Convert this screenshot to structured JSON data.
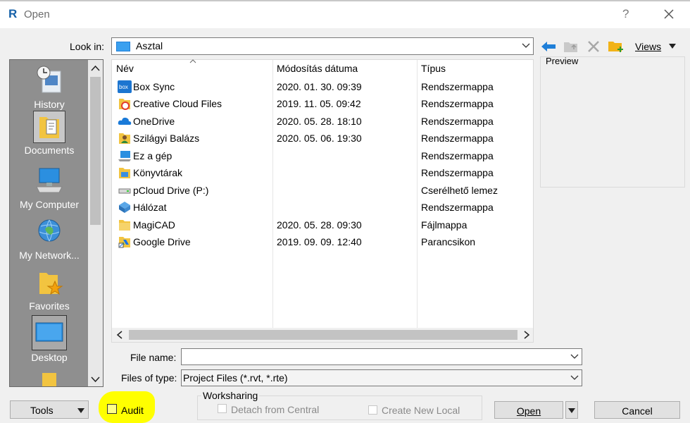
{
  "window": {
    "title": "Open",
    "help": "?"
  },
  "toolbar": {
    "lookin_label": "Look in:",
    "lookin_value": "Asztal",
    "views_label": "Views"
  },
  "preview": {
    "label": "Preview"
  },
  "places": [
    {
      "label": "History",
      "icon": "history-icon"
    },
    {
      "label": "Documents",
      "icon": "documents-icon"
    },
    {
      "label": "My Computer",
      "icon": "computer-icon"
    },
    {
      "label": "My Network...",
      "icon": "network-icon"
    },
    {
      "label": "Favorites",
      "icon": "favorites-icon"
    },
    {
      "label": "Desktop",
      "icon": "desktop-icon"
    }
  ],
  "files": {
    "columns": [
      "Név",
      "Módosítás dátuma",
      "Típus"
    ],
    "rows": [
      {
        "name": "Box Sync",
        "date": "2020. 01. 30. 09:39",
        "type": "Rendszermappa",
        "icon": "box-icon"
      },
      {
        "name": "Creative Cloud Files",
        "date": "2019. 11. 05. 09:42",
        "type": "Rendszermappa",
        "icon": "creative-cloud-icon"
      },
      {
        "name": "OneDrive",
        "date": "2020. 05. 28. 18:10",
        "type": "Rendszermappa",
        "icon": "onedrive-icon"
      },
      {
        "name": "Szilágyi Balázs",
        "date": "2020. 05. 06. 19:30",
        "type": "Rendszermappa",
        "icon": "user-folder-icon"
      },
      {
        "name": "Ez a gép",
        "date": "",
        "type": "Rendszermappa",
        "icon": "computer-icon"
      },
      {
        "name": "Könyvtárak",
        "date": "",
        "type": "Rendszermappa",
        "icon": "libraries-icon"
      },
      {
        "name": "pCloud Drive (P:)",
        "date": "",
        "type": "Cserélhető lemez",
        "icon": "drive-icon"
      },
      {
        "name": "Hálózat",
        "date": "",
        "type": "Rendszermappa",
        "icon": "network-icon"
      },
      {
        "name": "MagiCAD",
        "date": "2020. 05. 28. 09:30",
        "type": "Fájlmappa",
        "icon": "folder-icon"
      },
      {
        "name": "Google Drive",
        "date": "2019. 09. 09. 12:40",
        "type": "Parancsikon",
        "icon": "shortcut-icon"
      }
    ]
  },
  "form": {
    "filename_label": "File name:",
    "filename_value": "",
    "filetype_label": "Files of type:",
    "filetype_value": "Project Files  (*.rvt, *.rte)"
  },
  "bottom": {
    "tools_label": "Tools",
    "audit_label": "Audit",
    "worksharing_label": "Worksharing",
    "detach_label": "Detach from Central",
    "create_local_label": "Create New Local",
    "open_label": "Open",
    "cancel_label": "Cancel"
  },
  "colors": {
    "highlight": "#ffff00",
    "places_bg": "#8f8f8f",
    "accent_blue": "#1f7fd8",
    "folder": "#f4c542"
  }
}
